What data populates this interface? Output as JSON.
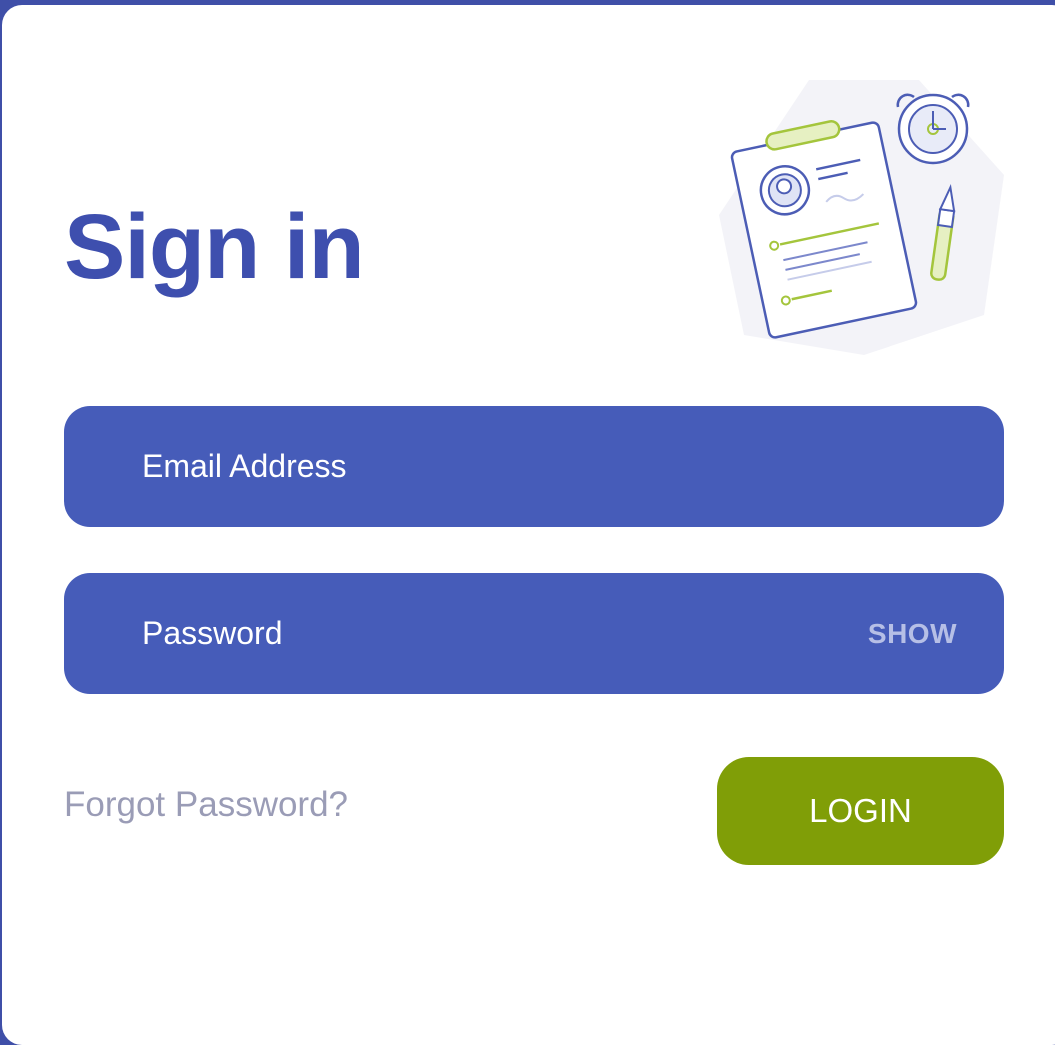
{
  "title": "Sign in",
  "email": {
    "placeholder": "Email Address"
  },
  "password": {
    "placeholder": "Password",
    "toggle_label": "SHOW"
  },
  "forgot_label": "Forgot Password?",
  "login_label": "LOGIN",
  "colors": {
    "frame": "#3f4fa8",
    "title": "#3e4fae",
    "field": "#465cb9",
    "login": "#809e07",
    "muted": "#9a9cb6"
  }
}
